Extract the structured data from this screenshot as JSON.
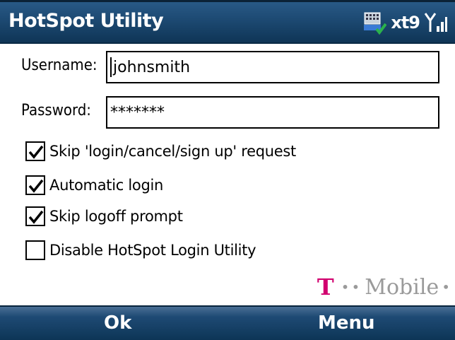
{
  "app": {
    "title": "HotSpot Utility"
  },
  "status_bar": {
    "input_mode": "xt9",
    "icons": [
      "connectivity-phone-icon",
      "signal-strength-icon"
    ]
  },
  "form": {
    "username": {
      "label": "Username:",
      "value": "johnsmith"
    },
    "password": {
      "label": "Password:",
      "value": "*******"
    }
  },
  "options": [
    {
      "label": "Skip 'login/cancel/sign up' request",
      "checked": true
    },
    {
      "label": "Automatic login",
      "checked": true
    },
    {
      "label": "Skip logoff prompt",
      "checked": true
    },
    {
      "label": "Disable HotSpot Login Utility",
      "checked": false
    }
  ],
  "branding": {
    "logo_letter": "T",
    "logo_text": "Mobile"
  },
  "softkeys": {
    "left": "Ok",
    "right": "Menu"
  },
  "colors": {
    "title_bar": "#1d4a73",
    "brand_magenta": "#d1006f",
    "brand_grey": "#9a9a9a"
  }
}
